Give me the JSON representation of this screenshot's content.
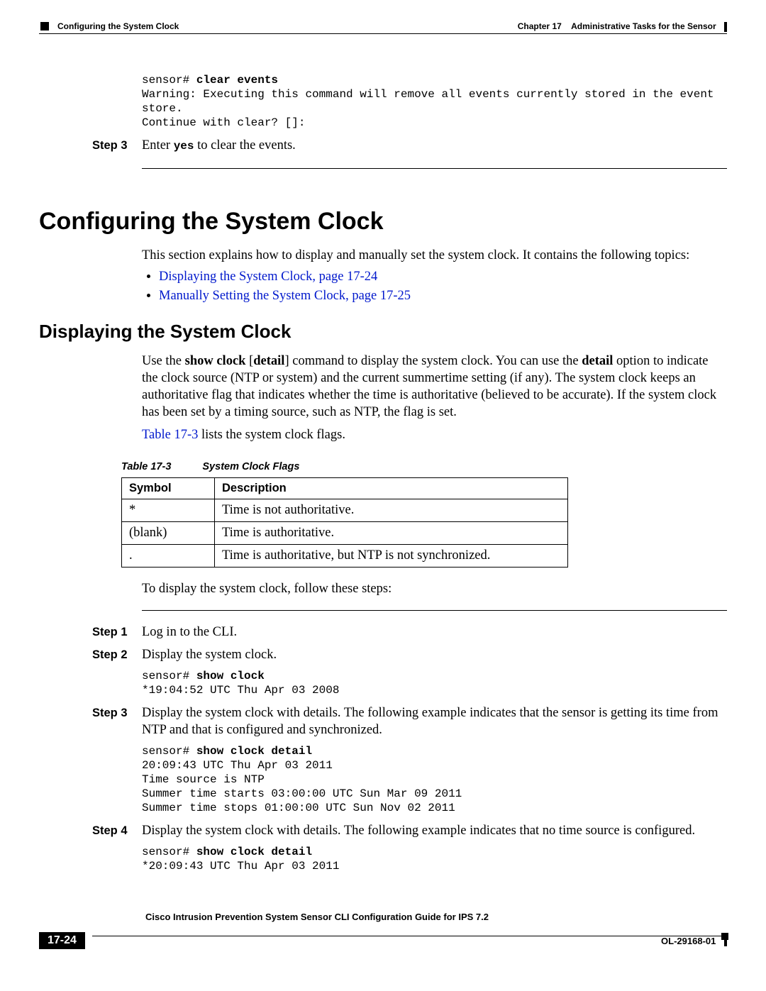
{
  "header": {
    "chapter": "Chapter 17",
    "chapter_title": "Administrative Tasks for the Sensor",
    "breadcrumb": "Configuring the System Clock"
  },
  "cli1": {
    "prompt": "sensor# ",
    "cmd": "clear events",
    "line2": "Warning: Executing this command will remove all events currently stored in the event",
    "line3": "store.",
    "line4": "Continue with clear? []:"
  },
  "step3a": {
    "label": "Step 3",
    "text_pre": "Enter ",
    "mono": "yes",
    "text_post": " to clear the events."
  },
  "h1": "Configuring the System Clock",
  "intro": "This section explains how to display and manually set the system clock. It contains the following topics:",
  "toc": [
    "Displaying the System Clock, page 17-24",
    "Manually Setting the System Clock, page 17-25"
  ],
  "h2": "Displaying the System Clock",
  "para1_a": "Use the ",
  "para1_b": "show clock",
  "para1_c": " [",
  "para1_d": "detail",
  "para1_e": "] command to display the system clock. You can use the ",
  "para1_f": "detail",
  "para1_g": " option to indicate the clock source (NTP or system) and the current summertime setting (if any). The system clock keeps an authoritative flag that indicates whether the time is authoritative (believed to be accurate). If the system clock has been set by a timing source, such as NTP, the flag is set.",
  "para2_link": "Table 17-3",
  "para2_rest": " lists the system clock flags.",
  "table": {
    "caption_label": "Table 17-3",
    "caption_title": "System Clock Flags",
    "headers": [
      "Symbol",
      "Description"
    ],
    "rows": [
      [
        "*",
        "Time is not authoritative."
      ],
      [
        "(blank)",
        "Time is authoritative."
      ],
      [
        ".",
        "Time is authoritative, but NTP is not synchronized."
      ]
    ]
  },
  "para3": "To display the system clock, follow these steps:",
  "steps": {
    "s1": {
      "label": "Step 1",
      "text": "Log in to the CLI."
    },
    "s2": {
      "label": "Step 2",
      "text": "Display the system clock."
    },
    "s3": {
      "label": "Step 3",
      "text": "Display the system clock with details. The following example indicates that the sensor is getting its time from NTP and that is configured and synchronized."
    },
    "s4": {
      "label": "Step 4",
      "text": "Display the system clock with details. The following example indicates that no time source is configured."
    }
  },
  "cli2": {
    "prompt": "sensor# ",
    "cmd": "show clock",
    "out1": "*19:04:52 UTC Thu Apr 03 2008"
  },
  "cli3": {
    "prompt": "sensor# ",
    "cmd": "show clock detail",
    "out1": "20:09:43 UTC Thu Apr 03 2011",
    "out2": "Time source is NTP",
    "out3": "Summer time starts 03:00:00 UTC Sun Mar 09 2011",
    "out4": "Summer time stops 01:00:00 UTC Sun Nov 02 2011"
  },
  "cli4": {
    "prompt": "sensor# ",
    "cmd": "show clock detail",
    "out1": "*20:09:43 UTC Thu Apr 03 2011"
  },
  "footer": {
    "title": "Cisco Intrusion Prevention System Sensor CLI Configuration Guide for IPS 7.2",
    "page": "17-24",
    "docid": "OL-29168-01"
  }
}
